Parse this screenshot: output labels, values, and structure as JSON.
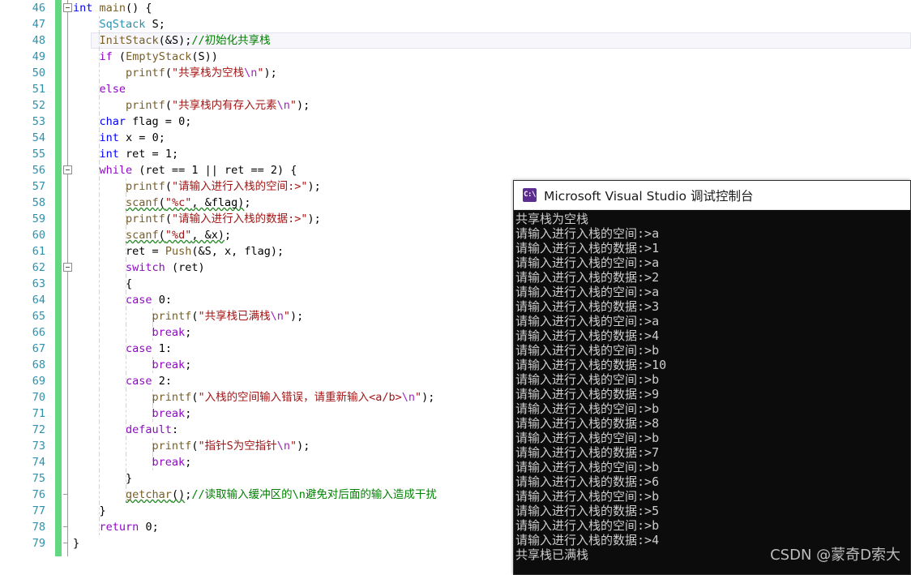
{
  "editor": {
    "first_line_number": 46,
    "current_line_number": 48,
    "change_bar_color": "#62d882",
    "line_number_color": "#2b91af",
    "lines": [
      {
        "num": "46",
        "fold": "minus",
        "indent_guides": [],
        "html": "<span class=\"k\">int</span> <span class=\"f\">main</span><span class=\"p\">() {</span>"
      },
      {
        "num": "47",
        "fold": "",
        "indent_guides": [
          122
        ],
        "html": "    <span class=\"t\">SqStack</span> <span class=\"p\">S;</span>"
      },
      {
        "num": "48",
        "fold": "",
        "indent_guides": [
          122
        ],
        "html": "    <span class=\"f\">InitStack</span><span class=\"p\">(&amp;</span><span class=\"p\">S);</span><span class=\"c\">//初始化共享栈</span>"
      },
      {
        "num": "49",
        "fold": "",
        "indent_guides": [
          122
        ],
        "html": "    <span class=\"kp\">if</span> <span class=\"p\">(</span><span class=\"f\">EmptyStack</span><span class=\"p\">(S))</span>"
      },
      {
        "num": "50",
        "fold": "",
        "indent_guides": [
          122
        ],
        "html": "        <span class=\"f\">printf</span><span class=\"p\">(</span><span class=\"s\">\"共享栈为空栈</span><span class=\"e\">\\n</span><span class=\"s\">\"</span><span class=\"p\">);</span>"
      },
      {
        "num": "51",
        "fold": "",
        "indent_guides": [
          122
        ],
        "html": "    <span class=\"kp\">else</span>"
      },
      {
        "num": "52",
        "fold": "",
        "indent_guides": [
          122
        ],
        "html": "        <span class=\"f\">printf</span><span class=\"p\">(</span><span class=\"s\">\"共享栈内有存入元素</span><span class=\"e\">\\n</span><span class=\"s\">\"</span><span class=\"p\">);</span>"
      },
      {
        "num": "53",
        "fold": "",
        "indent_guides": [
          122
        ],
        "html": "    <span class=\"k\">char</span> <span class=\"p\">flag = </span><span class=\"n\">0</span><span class=\"p\">;</span>"
      },
      {
        "num": "54",
        "fold": "",
        "indent_guides": [
          122
        ],
        "html": "    <span class=\"k\">int</span> <span class=\"p\">x = </span><span class=\"n\">0</span><span class=\"p\">;</span>"
      },
      {
        "num": "55",
        "fold": "",
        "indent_guides": [
          122
        ],
        "html": "    <span class=\"k\">int</span> <span class=\"p\">ret = </span><span class=\"n\">1</span><span class=\"p\">;</span>"
      },
      {
        "num": "56",
        "fold": "minus",
        "indent_guides": [
          122
        ],
        "html": "    <span class=\"kp\">while</span> <span class=\"p\">(ret == </span><span class=\"n\">1</span><span class=\"p\"> || ret == </span><span class=\"n\">2</span><span class=\"p\">) {</span>"
      },
      {
        "num": "57",
        "fold": "",
        "indent_guides": [
          122,
          155
        ],
        "html": "        <span class=\"f\">printf</span><span class=\"p\">(</span><span class=\"s\">\"请输入进行入栈的空间:&gt;\"</span><span class=\"p\">);</span>"
      },
      {
        "num": "58",
        "fold": "",
        "indent_guides": [
          122,
          155
        ],
        "html": "        <span class=\"f sq\">scanf</span><span class=\"p sq\">(</span><span class=\"s sq\">\"%c\"</span><span class=\"p sq\">, &amp;flag)</span><span class=\"p\">;</span>"
      },
      {
        "num": "59",
        "fold": "",
        "indent_guides": [
          122,
          155
        ],
        "html": "        <span class=\"f\">printf</span><span class=\"p\">(</span><span class=\"s\">\"请输入进行入栈的数据:&gt;\"</span><span class=\"p\">);</span>"
      },
      {
        "num": "60",
        "fold": "",
        "indent_guides": [
          122,
          155
        ],
        "html": "        <span class=\"f sq\">scanf</span><span class=\"p sq\">(</span><span class=\"s sq\">\"%d\"</span><span class=\"p sq\">, &amp;x)</span><span class=\"p\">;</span>"
      },
      {
        "num": "61",
        "fold": "",
        "indent_guides": [
          122,
          155
        ],
        "html": "        <span class=\"p\">ret = </span><span class=\"f\">Push</span><span class=\"p\">(&amp;S, x, flag);</span>"
      },
      {
        "num": "62",
        "fold": "minus",
        "indent_guides": [
          122,
          155
        ],
        "html": "        <span class=\"kp\">switch</span> <span class=\"p\">(ret)</span>"
      },
      {
        "num": "63",
        "fold": "",
        "indent_guides": [
          122,
          155
        ],
        "html": "        <span class=\"p\">{</span>"
      },
      {
        "num": "64",
        "fold": "",
        "indent_guides": [
          122,
          155
        ],
        "html": "        <span class=\"kp\">case</span> <span class=\"n\">0</span><span class=\"p\">:</span>"
      },
      {
        "num": "65",
        "fold": "",
        "indent_guides": [
          122,
          155,
          188
        ],
        "html": "            <span class=\"f\">printf</span><span class=\"p\">(</span><span class=\"s\">\"共享栈已满栈</span><span class=\"e\">\\n</span><span class=\"s\">\"</span><span class=\"p\">);</span>"
      },
      {
        "num": "66",
        "fold": "",
        "indent_guides": [
          122,
          155,
          188
        ],
        "html": "            <span class=\"kp\">break</span><span class=\"p\">;</span>"
      },
      {
        "num": "67",
        "fold": "",
        "indent_guides": [
          122,
          155
        ],
        "html": "        <span class=\"kp\">case</span> <span class=\"n\">1</span><span class=\"p\">:</span>"
      },
      {
        "num": "68",
        "fold": "",
        "indent_guides": [
          122,
          155,
          188
        ],
        "html": "            <span class=\"kp\">break</span><span class=\"p\">;</span>"
      },
      {
        "num": "69",
        "fold": "",
        "indent_guides": [
          122,
          155
        ],
        "html": "        <span class=\"kp\">case</span> <span class=\"n\">2</span><span class=\"p\">:</span>"
      },
      {
        "num": "70",
        "fold": "",
        "indent_guides": [
          122,
          155,
          188
        ],
        "html": "            <span class=\"f\">printf</span><span class=\"p\">(</span><span class=\"s\">\"入栈的空间输入错误，请重新输入&lt;a/b&gt;</span><span class=\"e\">\\n</span><span class=\"s\">\"</span><span class=\"p\">);</span>"
      },
      {
        "num": "71",
        "fold": "",
        "indent_guides": [
          122,
          155,
          188
        ],
        "html": "            <span class=\"kp\">break</span><span class=\"p\">;</span>"
      },
      {
        "num": "72",
        "fold": "",
        "indent_guides": [
          122,
          155
        ],
        "html": "        <span class=\"kp\">default</span><span class=\"p\">:</span>"
      },
      {
        "num": "73",
        "fold": "",
        "indent_guides": [
          122,
          155,
          188
        ],
        "html": "            <span class=\"f\">printf</span><span class=\"p\">(</span><span class=\"s\">\"指针S为空指针</span><span class=\"e\">\\n</span><span class=\"s\">\"</span><span class=\"p\">);</span>"
      },
      {
        "num": "74",
        "fold": "",
        "indent_guides": [
          122,
          155,
          188
        ],
        "html": "            <span class=\"kp\">break</span><span class=\"p\">;</span>"
      },
      {
        "num": "75",
        "fold": "",
        "indent_guides": [
          122,
          155
        ],
        "html": "        <span class=\"p\">}</span>"
      },
      {
        "num": "76",
        "fold": "end",
        "indent_guides": [
          122,
          155
        ],
        "html": "        <span class=\"f sq\">getchar</span><span class=\"p sq\">()</span><span class=\"p\">;</span><span class=\"c\">//读取输入缓冲区的\\n避免对后面的输入造成干扰</span>"
      },
      {
        "num": "77",
        "fold": "",
        "indent_guides": [
          122
        ],
        "html": "    <span class=\"p\">}</span>"
      },
      {
        "num": "78",
        "fold": "end",
        "indent_guides": [
          122
        ],
        "html": "    <span class=\"kp\">return</span> <span class=\"n\">0</span><span class=\"p\">;</span>"
      },
      {
        "num": "79",
        "fold": "end",
        "indent_guides": [],
        "html": "<span class=\"p\">}</span>"
      }
    ]
  },
  "console": {
    "title": "Microsoft Visual Studio 调试控制台",
    "icon_label": "C:\\",
    "background_color": "#0c0c0c",
    "text_color": "#cccccc",
    "lines": [
      "共享栈为空栈",
      "请输入进行入栈的空间:>a",
      "请输入进行入栈的数据:>1",
      "请输入进行入栈的空间:>a",
      "请输入进行入栈的数据:>2",
      "请输入进行入栈的空间:>a",
      "请输入进行入栈的数据:>3",
      "请输入进行入栈的空间:>a",
      "请输入进行入栈的数据:>4",
      "请输入进行入栈的空间:>b",
      "请输入进行入栈的数据:>10",
      "请输入进行入栈的空间:>b",
      "请输入进行入栈的数据:>9",
      "请输入进行入栈的空间:>b",
      "请输入进行入栈的数据:>8",
      "请输入进行入栈的空间:>b",
      "请输入进行入栈的数据:>7",
      "请输入进行入栈的空间:>b",
      "请输入进行入栈的数据:>6",
      "请输入进行入栈的空间:>b",
      "请输入进行入栈的数据:>5",
      "请输入进行入栈的空间:>b",
      "请输入进行入栈的数据:>4",
      "共享栈已满栈"
    ]
  },
  "watermark": {
    "text": "CSDN @蒙奇D索大"
  }
}
